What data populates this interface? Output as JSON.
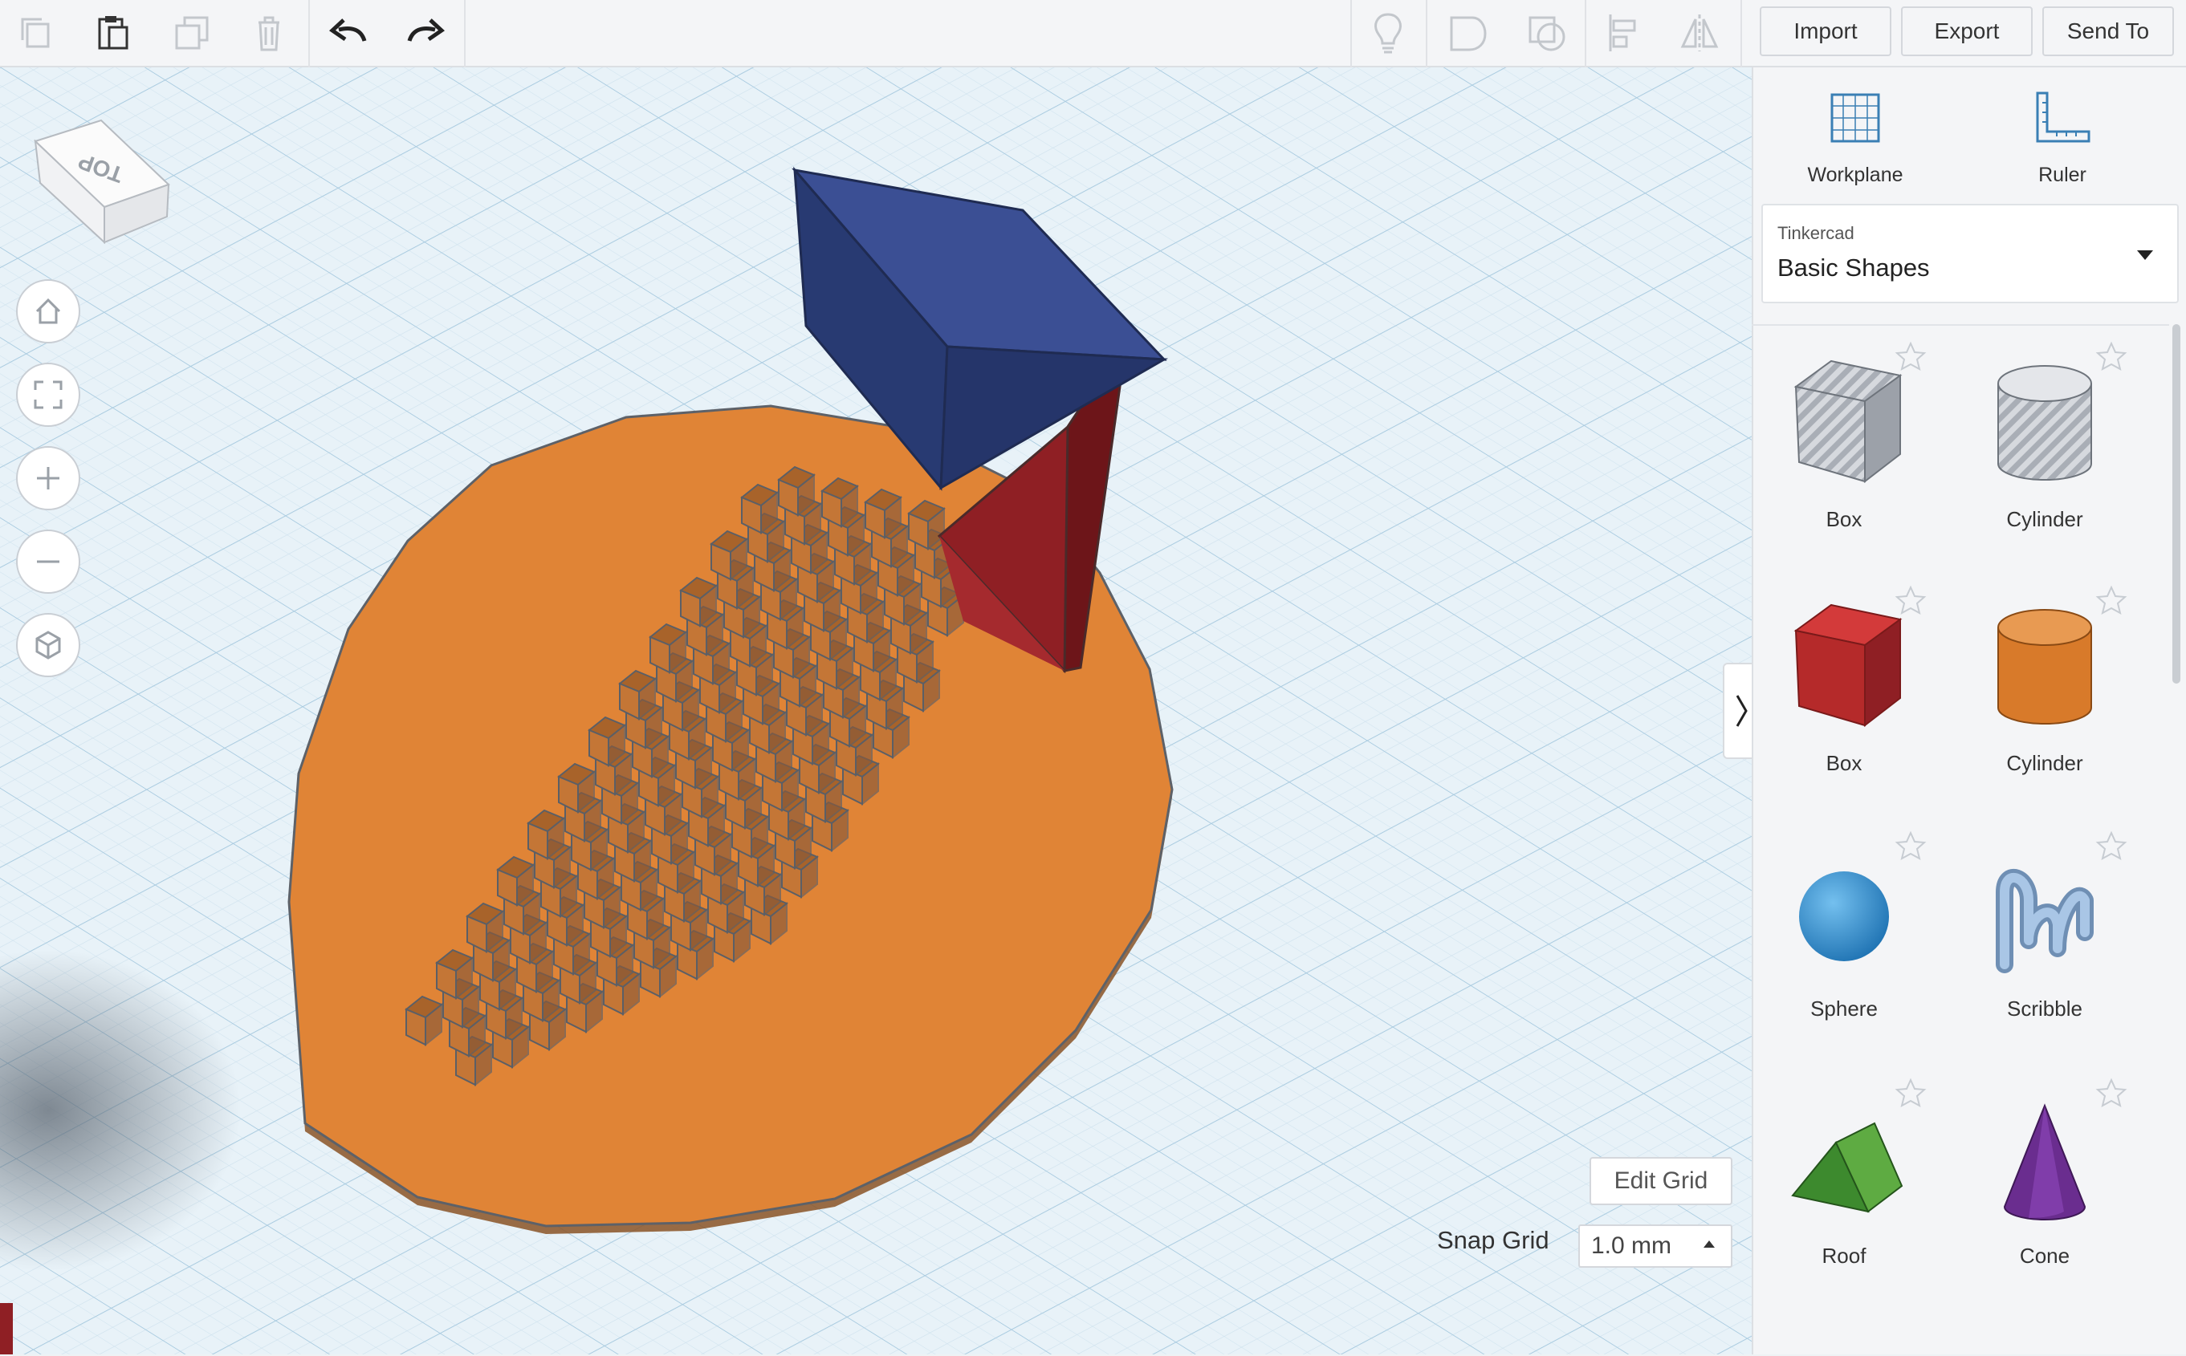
{
  "toolbar": {
    "import_label": "Import",
    "export_label": "Export",
    "send_to_label": "Send To"
  },
  "viewcube": {
    "face_label": "TOP"
  },
  "panel": {
    "workplane_label": "Workplane",
    "ruler_label": "Ruler",
    "library": {
      "provider": "Tinkercad",
      "selected": "Basic Shapes"
    },
    "shapes": [
      {
        "name": "Box",
        "icon": "box-hole-icon"
      },
      {
        "name": "Cylinder",
        "icon": "cylinder-hole-icon"
      },
      {
        "name": "Box",
        "icon": "box-icon"
      },
      {
        "name": "Cylinder",
        "icon": "cylinder-icon"
      },
      {
        "name": "Sphere",
        "icon": "sphere-icon"
      },
      {
        "name": "Scribble",
        "icon": "scribble-icon"
      },
      {
        "name": "Roof",
        "icon": "roof-icon"
      },
      {
        "name": "Cone",
        "icon": "cone-icon"
      }
    ]
  },
  "grid_controls": {
    "edit_grid_label": "Edit Grid",
    "snap_grid_label": "Snap Grid",
    "snap_grid_value": "1.0 mm"
  },
  "colors": {
    "accent_blue": "#3b4f94",
    "red": "#8f1f24",
    "orange": "#e08436",
    "grid_bg": "#e8f2f8"
  }
}
